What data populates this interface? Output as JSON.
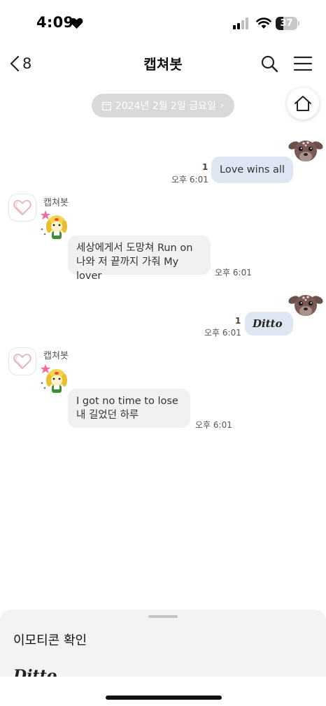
{
  "status_bar": {
    "time": "4:09",
    "battery_level": "37",
    "battery_fraction": 0.37
  },
  "nav": {
    "back_count": "8",
    "title": "캡쳐봇",
    "icons": [
      "chevron-left-icon",
      "search-icon",
      "menu-icon"
    ]
  },
  "date_banner": "2024년 2월 2일 금요일",
  "date_chevron": "›",
  "messages": [
    {
      "side": "mine",
      "read": "1",
      "time": "오후 6:01",
      "text": "Love wins all"
    },
    {
      "side": "theirs",
      "sender": "캡쳐봇",
      "time": "오후 6:01",
      "lines": [
        "세상에게서 도망쳐 Run on",
        "나와 저 끝까지 가줘 My lover"
      ]
    },
    {
      "side": "mine",
      "read": "1",
      "time": "오후 6:01",
      "text": "Ditto"
    },
    {
      "side": "theirs",
      "sender": "캡쳐봇",
      "time": "오후 6:01",
      "lines": [
        "I got no time to lose",
        "내 길었던 하루"
      ]
    }
  ],
  "bottom_sheet": {
    "title": "이모티콘 확인",
    "preview": "Ditto"
  },
  "colors": {
    "mine_bubble": "#dde6f2",
    "theirs_bubble": "#f3f1ef",
    "date_pill": "#d9d9d9"
  }
}
